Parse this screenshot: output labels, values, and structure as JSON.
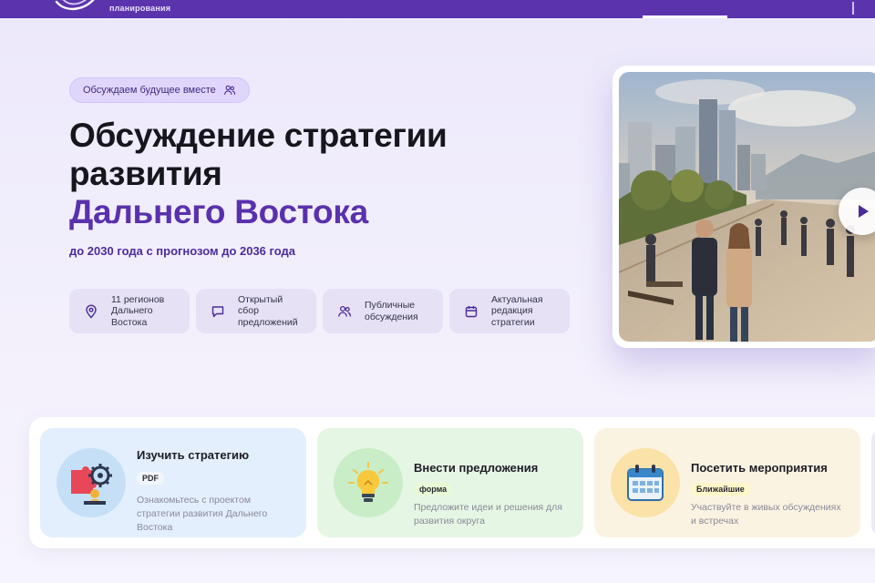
{
  "header": {
    "logo_text": "планирования",
    "brand_color": "#5b34ad"
  },
  "hero": {
    "pill_label": "Обсуждаем будущее вместе",
    "title_line1": "Обсуждение стратегии",
    "title_line2": "развития",
    "title_accent": "Дальнего Востока",
    "subtitle": "до 2030 года с прогнозом до 2036 года",
    "accent_color": "#5a31ad"
  },
  "features": [
    {
      "icon": "location-pin-icon",
      "l1": "11 регионов",
      "l2": "Дальнего",
      "l3": "Востока"
    },
    {
      "icon": "chat-bubble-icon",
      "l1": "Открытый",
      "l2": "сбор",
      "l3": "предложений"
    },
    {
      "icon": "people-icon",
      "l1": "Публичные",
      "l2": "обсуждения",
      "l3": ""
    },
    {
      "icon": "calendar-icon",
      "l1": "Актуальная",
      "l2": "редакция",
      "l3": "стратегии"
    }
  ],
  "video": {
    "play_icon": "play-icon"
  },
  "actions": [
    {
      "title": "Изучить стратегию",
      "badge": "PDF",
      "desc": "Ознакомьтесь с проектом стратегии развития Дальнего Востока",
      "icon": "strategy-gears-icon"
    },
    {
      "title": "Внести предложения",
      "badge": "форма",
      "desc": "Предложите идеи и решения для развития округа",
      "icon": "lightbulb-icon"
    },
    {
      "title": "Посетить мероприятия",
      "badge": "Ближайшие",
      "desc": "Участвуйте в живых обсуждениях и встречах",
      "icon": "calendar-icon"
    }
  ]
}
